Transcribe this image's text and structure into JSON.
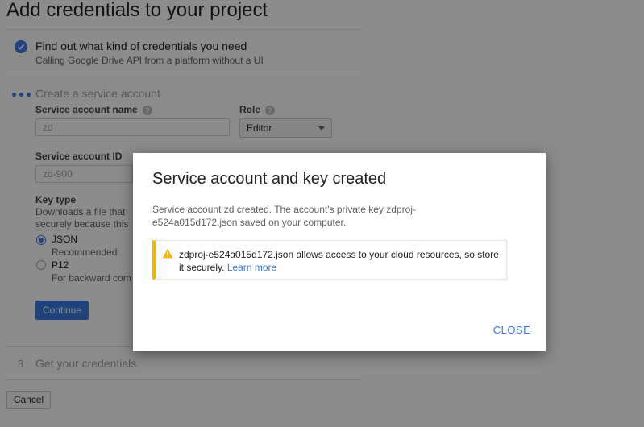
{
  "page": {
    "title": "Add credentials to your project"
  },
  "steps": {
    "step1": {
      "title": "Find out what kind of credentials you need",
      "subtitle": "Calling Google Drive API from a platform without a UI"
    },
    "step2": {
      "title": "Create a service account",
      "service_account_name_label": "Service account name",
      "service_account_name_value": "zd",
      "role_label": "Role",
      "role_value": "Editor",
      "service_account_id_label": "Service account ID",
      "service_account_id_value": "zd-900",
      "key_type_label": "Key type",
      "key_type_desc_line1": "Downloads a file that",
      "key_type_desc_line2": "securely because this",
      "options": [
        {
          "label": "JSON",
          "sub": "Recommended",
          "selected": true
        },
        {
          "label": "P12",
          "sub": "For backward com",
          "selected": false
        }
      ],
      "continue_label": "Continue"
    },
    "step3": {
      "number": "3",
      "title": "Get your credentials"
    }
  },
  "footer": {
    "cancel_label": "Cancel"
  },
  "dialog": {
    "title": "Service account and key created",
    "body": "Service account zd created. The account's private key zdproj-e524a015d172.json saved on your computer.",
    "warning_text": "zdproj-e524a015d172.json allows access to your cloud resources, so store it securely.",
    "warning_link": "Learn more",
    "close_label": "CLOSE"
  },
  "icons": {
    "check": "check-circle-icon",
    "help": "help-icon",
    "warning": "warning-icon",
    "dropdown": "caret-down-icon"
  },
  "colors": {
    "accent": "#3b78e7",
    "warning": "#f4b400"
  }
}
